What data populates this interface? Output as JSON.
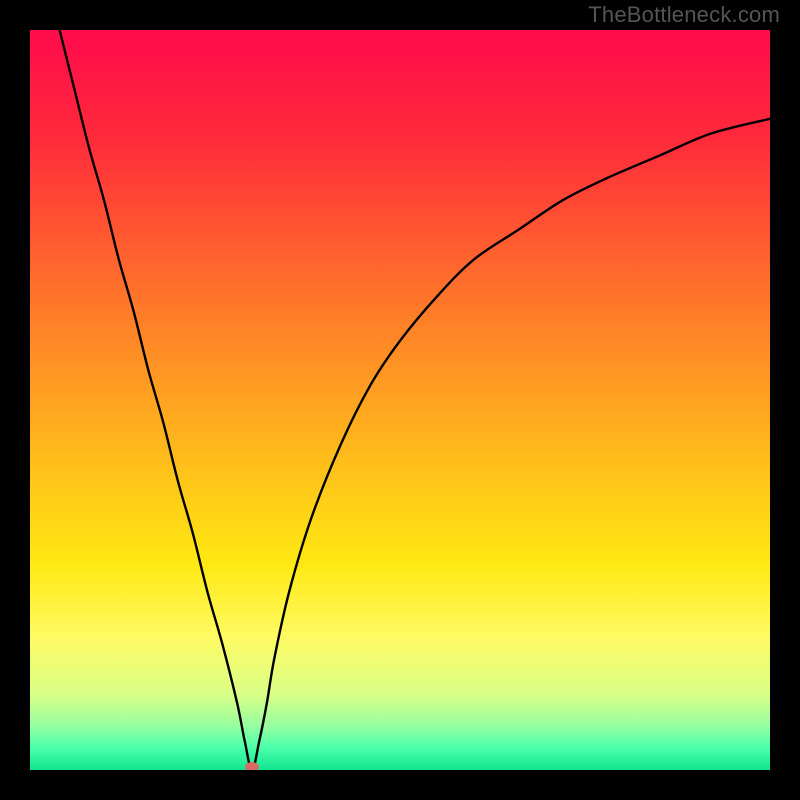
{
  "watermark": "TheBottleneck.com",
  "chart_data": {
    "type": "line",
    "title": "",
    "xlabel": "",
    "ylabel": "",
    "xlim": [
      0,
      100
    ],
    "ylim": [
      0,
      100
    ],
    "grid": false,
    "background_gradient": {
      "stops": [
        {
          "offset": 0.0,
          "color": "#ff0b4b"
        },
        {
          "offset": 0.15,
          "color": "#ff2b3a"
        },
        {
          "offset": 0.3,
          "color": "#ff602f"
        },
        {
          "offset": 0.45,
          "color": "#ff9224"
        },
        {
          "offset": 0.6,
          "color": "#ffc31a"
        },
        {
          "offset": 0.72,
          "color": "#ffe812"
        },
        {
          "offset": 0.82,
          "color": "#fffb63"
        },
        {
          "offset": 0.9,
          "color": "#d7ff88"
        },
        {
          "offset": 0.94,
          "color": "#97ffa0"
        },
        {
          "offset": 0.97,
          "color": "#4bffab"
        },
        {
          "offset": 1.0,
          "color": "#11e58f"
        }
      ]
    },
    "marker": {
      "x": 30,
      "y": 0,
      "color": "#d66a64",
      "r": 1.0
    },
    "series": [
      {
        "name": "curve",
        "x": [
          4,
          6,
          8,
          10,
          12,
          14,
          16,
          18,
          20,
          22,
          24,
          26,
          28,
          29,
          30,
          31,
          32,
          33,
          35,
          38,
          42,
          46,
          50,
          55,
          60,
          66,
          72,
          78,
          85,
          92,
          100
        ],
        "y": [
          100,
          92,
          84,
          77,
          69,
          62,
          54,
          47,
          39,
          32,
          24,
          17,
          9,
          4,
          0,
          4,
          9,
          15,
          24,
          34,
          44,
          52,
          58,
          64,
          69,
          73,
          77,
          80,
          83,
          86,
          88
        ]
      }
    ]
  }
}
